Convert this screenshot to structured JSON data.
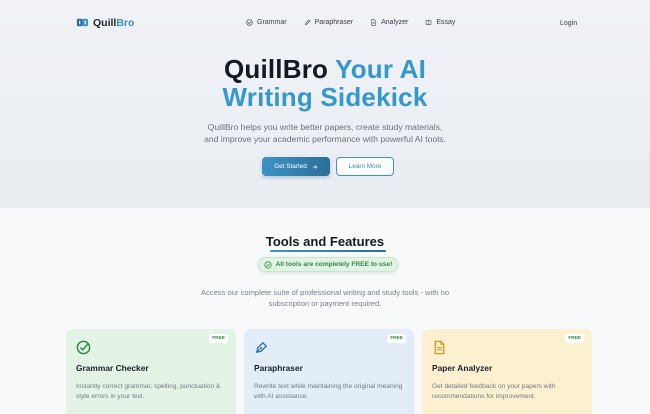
{
  "nav": {
    "logo": {
      "name_prefix": "Quill",
      "name_accent": "Bro"
    },
    "links": [
      {
        "label": "Grammar",
        "icon": "check-circle-icon"
      },
      {
        "label": "Paraphraser",
        "icon": "pen-icon"
      },
      {
        "label": "Analyzer",
        "icon": "document-icon"
      },
      {
        "label": "Essay",
        "icon": "book-icon"
      }
    ],
    "login_label": "Login"
  },
  "hero": {
    "title_dark": "QuillBro",
    "title_blue_1": "Your AI",
    "title_blue_2": "Writing Sidekick",
    "subtitle_line1": "QuillBro helps you write better papers, create study materials,",
    "subtitle_line2": "and improve your academic performance with powerful AI tools.",
    "primary_button": "Get Started",
    "secondary_button": "Learn More"
  },
  "tools": {
    "title": "Tools and Features",
    "free_pill": "All tools are completely FREE to use!",
    "desc_line1": "Access our complete suite of professional writing and study tools - with no",
    "desc_line2": "subscription or payment required.",
    "cards": [
      {
        "badge": "FREE",
        "title": "Grammar Checker",
        "desc": "Instantly correct grammar, spelling, punctuation & style errors in your text.",
        "icon": "check-circle-icon"
      },
      {
        "badge": "FREE",
        "title": "Paraphraser",
        "desc": "Rewrite text while maintaining the original meaning with AI assistance.",
        "icon": "pen-nib-icon"
      },
      {
        "badge": "FREE",
        "title": "Paper Analyzer",
        "desc": "Get detailed feedback on your papers with recommendations for improvement.",
        "icon": "document-icon"
      }
    ]
  },
  "colors": {
    "accent_blue": "#3597cc",
    "button_blue_dark": "#2b6e97",
    "free_green": "#2f8a43",
    "card_green": "#e3f4e6",
    "card_blue": "#e2edf8",
    "card_yellow": "#fbf1d1"
  }
}
